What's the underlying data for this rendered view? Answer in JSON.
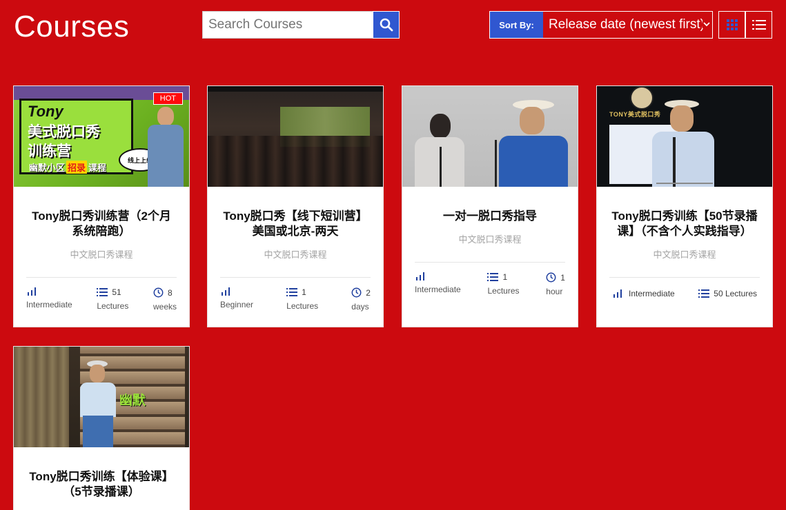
{
  "header": {
    "title": "Courses",
    "search_placeholder": "Search Courses",
    "sort_label": "Sort By:",
    "sort_value": "Release date (newest first)"
  },
  "colors": {
    "background": "#cc0a0f",
    "accent": "#3057d0",
    "hot": "#ff0b0b"
  },
  "courses": [
    {
      "title": "Tony脱口秀训练营（2个月系统陪跑）",
      "subtitle": "中文脱口秀课程",
      "badge": "HOT",
      "thumb_text": {
        "line1": "Tony",
        "line2": "美式脱口秀",
        "line3": "训练营",
        "line4": "幽默小区",
        "line5": "招录",
        "line6": "课程",
        "line7": "线上上线"
      },
      "level": "Intermediate",
      "lectures_num": "51",
      "lectures_label": "Lectures",
      "duration_num": "8",
      "duration_label": "weeks"
    },
    {
      "title": "Tony脱口秀【线下短训营】美国或北京-两天",
      "subtitle": "中文脱口秀课程",
      "level": "Beginner",
      "lectures_num": "1",
      "lectures_label": "Lectures",
      "duration_num": "2",
      "duration_label": "days"
    },
    {
      "title": "一对一脱口秀指导",
      "subtitle": "中文脱口秀课程",
      "level": "Intermediate",
      "lectures_num": "1",
      "lectures_label": "Lectures",
      "duration_num": "1",
      "duration_label": "hour"
    },
    {
      "title": "Tony脱口秀训练【50节录播课】（不含个人实践指导）",
      "subtitle": "中文脱口秀课程",
      "thumb_text": {
        "brand": "TONY美式脱口秀"
      },
      "level": "Intermediate",
      "lectures_full": "50 Lectures"
    },
    {
      "title": "Tony脱口秀训练【体验课】（5节录播课）",
      "thumb_text": {
        "sign": "幽默"
      }
    }
  ]
}
